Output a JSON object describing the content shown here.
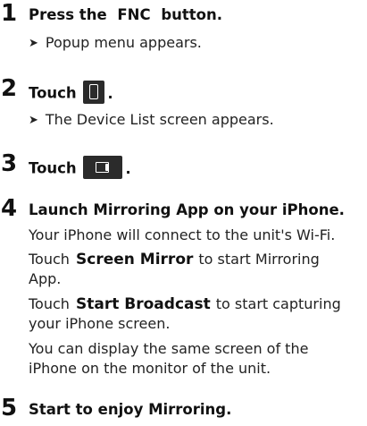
{
  "steps": [
    {
      "num": "1",
      "title_pre": "Press the ",
      "title_kw": "FNC",
      "title_post": " button.",
      "result_marker": "➤",
      "result": "Popup menu appears."
    },
    {
      "num": "2",
      "title": "Touch",
      "icon": "phone-link-icon",
      "title_end": ".",
      "result_marker": "➤",
      "result": "The Device List screen appears."
    },
    {
      "num": "3",
      "title": "Touch",
      "icon": "screen-mirror-icon",
      "title_end": "."
    },
    {
      "num": "4",
      "title": "Launch Mirroring App on your iPhone.",
      "lines": [
        {
          "text": "Your iPhone will connect to the unit's Wi-Fi."
        },
        {
          "pre": "Touch",
          "kw": "Screen Mirror",
          "post": "to start Mirroring"
        },
        {
          "text": "App."
        },
        {
          "pre": "Touch",
          "kw": "Start Broadcast",
          "post": "to start capturing"
        },
        {
          "text": "your iPhone screen."
        },
        {
          "text": "You can display the same screen of the"
        },
        {
          "text": "iPhone on the monitor of the unit."
        }
      ]
    },
    {
      "num": "5",
      "title": "Start to enjoy Mirroring."
    }
  ],
  "colors": {
    "text": "#111111",
    "icon_bg": "#2b2b2b"
  }
}
